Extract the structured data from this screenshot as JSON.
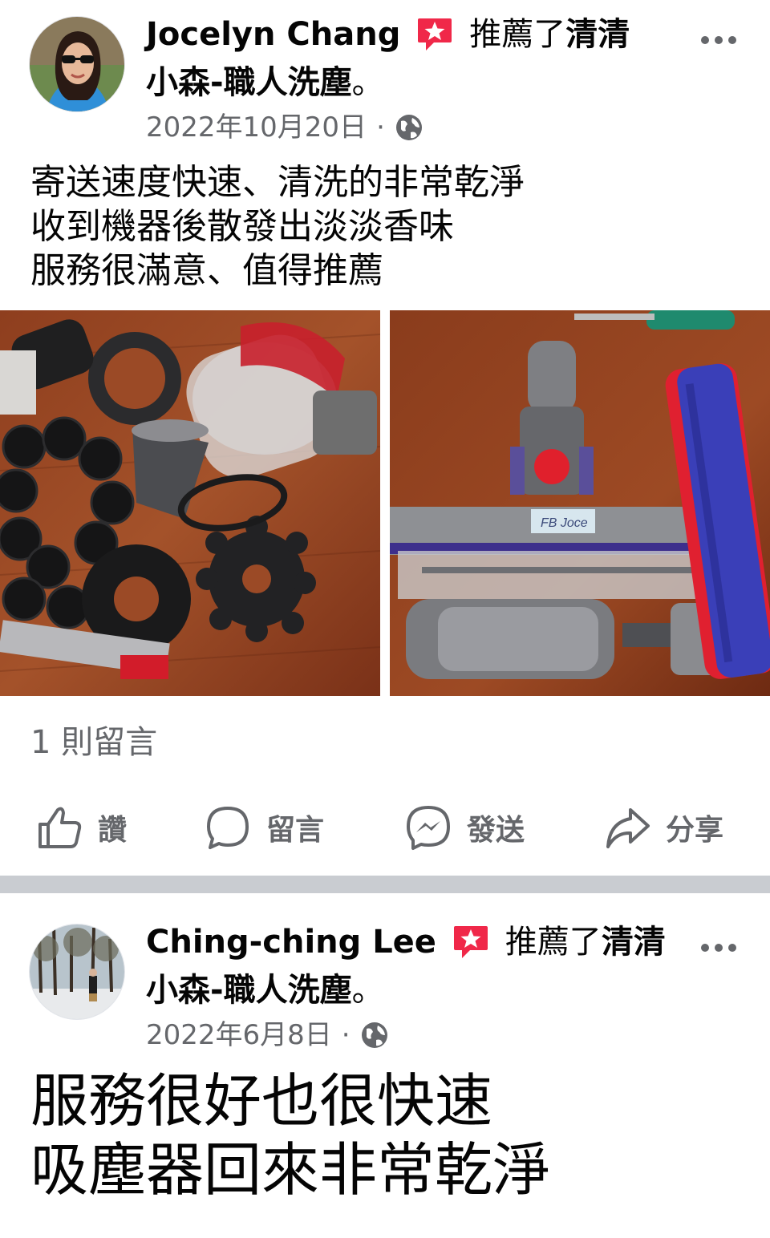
{
  "posts": [
    {
      "author": "Jocelyn Chang",
      "recommend_text": "推薦了",
      "page_name_part1": "清清",
      "page_name_part2": "小森-職人洗塵",
      "period": "。",
      "date": "2022年10月20日",
      "dot": "·",
      "privacy_icon": "globe-icon",
      "body_lines": [
        "寄送速度快速、清洗的非常乾淨",
        "收到機器後散發出淡淡香味",
        "服務很滿意、值得推薦"
      ],
      "photos": [
        "disassembled-vacuum-parts",
        "vacuum-floor-head-brush-roll"
      ],
      "photo_label": "FB Joce",
      "comments_count": "1 則留言",
      "actions": {
        "like": "讚",
        "comment": "留言",
        "send": "發送",
        "share": "分享"
      }
    },
    {
      "author": "Ching-ching Lee",
      "recommend_text": "推薦了",
      "page_name_part1": "清清",
      "page_name_part2": "小森-職人洗塵",
      "period": "。",
      "date": "2022年6月8日",
      "dot": "·",
      "privacy_icon": "globe-icon",
      "body_lines": [
        "服務很好也很快速",
        "吸塵器回來非常乾淨"
      ]
    }
  ],
  "colors": {
    "text": "#050505",
    "secondary": "#65676b",
    "divider": "#c9ccd1",
    "recommend_badge": "#f02849"
  }
}
